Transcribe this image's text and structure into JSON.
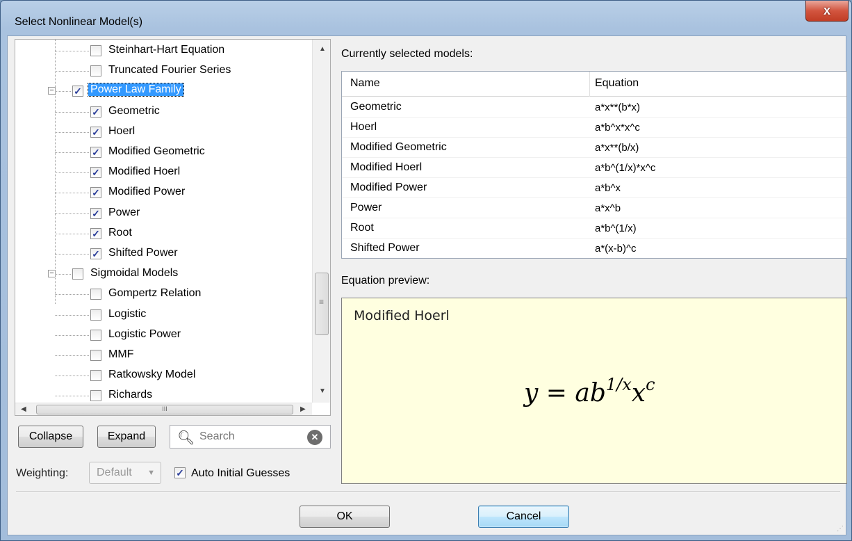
{
  "window": {
    "title": "Select Nonlinear Model(s)",
    "close_glyph": "x"
  },
  "tree": {
    "items": [
      {
        "label": "Steinhart-Hart Equation",
        "checked": false,
        "level": 2
      },
      {
        "label": "Truncated Fourier Series",
        "checked": false,
        "level": 2
      },
      {
        "label": "Power Law Family",
        "checked": true,
        "level": 1,
        "selected": true
      },
      {
        "label": "Geometric",
        "checked": true,
        "level": 2
      },
      {
        "label": "Hoerl",
        "checked": true,
        "level": 2
      },
      {
        "label": "Modified Geometric",
        "checked": true,
        "level": 2
      },
      {
        "label": "Modified Hoerl",
        "checked": true,
        "level": 2
      },
      {
        "label": "Modified Power",
        "checked": true,
        "level": 2
      },
      {
        "label": "Power",
        "checked": true,
        "level": 2
      },
      {
        "label": "Root",
        "checked": true,
        "level": 2
      },
      {
        "label": "Shifted Power",
        "checked": true,
        "level": 2
      },
      {
        "label": "Sigmoidal Models",
        "checked": false,
        "level": 1
      },
      {
        "label": "Gompertz Relation",
        "checked": false,
        "level": 2
      },
      {
        "label": "Logistic",
        "checked": false,
        "level": 2
      },
      {
        "label": "Logistic Power",
        "checked": false,
        "level": 2
      },
      {
        "label": "MMF",
        "checked": false,
        "level": 2
      },
      {
        "label": "Ratkowsky Model",
        "checked": false,
        "level": 2
      },
      {
        "label": "Richards",
        "checked": false,
        "level": 2
      }
    ],
    "scroll_thumb_glyph": "≡",
    "hscroll_thumb_glyph": "III"
  },
  "buttons": {
    "collapse": "Collapse",
    "expand": "Expand",
    "ok": "OK",
    "cancel": "Cancel"
  },
  "search": {
    "placeholder": "Search",
    "value": ""
  },
  "weighting": {
    "label": "Weighting:",
    "value": "Default"
  },
  "auto_guesses": {
    "label": "Auto Initial Guesses",
    "checked": true
  },
  "selected_models": {
    "label": "Currently selected models:",
    "columns": [
      "Name",
      "Equation"
    ],
    "rows": [
      {
        "name": "Geometric",
        "equation": "a*x**(b*x)"
      },
      {
        "name": "Hoerl",
        "equation": "a*b^x*x^c"
      },
      {
        "name": "Modified Geometric",
        "equation": "a*x**(b/x)"
      },
      {
        "name": "Modified Hoerl",
        "equation": "a*b^(1/x)*x^c"
      },
      {
        "name": "Modified Power",
        "equation": "a*b^x"
      },
      {
        "name": "Power",
        "equation": "a*x^b"
      },
      {
        "name": "Root",
        "equation": "a*b^(1/x)"
      },
      {
        "name": "Shifted Power",
        "equation": "a*(x-b)^c"
      }
    ]
  },
  "preview": {
    "label": "Equation preview:",
    "model_name": "Modified Hoerl",
    "equation_base": "y = ab",
    "equation_sup1": "1/x",
    "equation_mid": "x",
    "equation_sup2": "c"
  }
}
